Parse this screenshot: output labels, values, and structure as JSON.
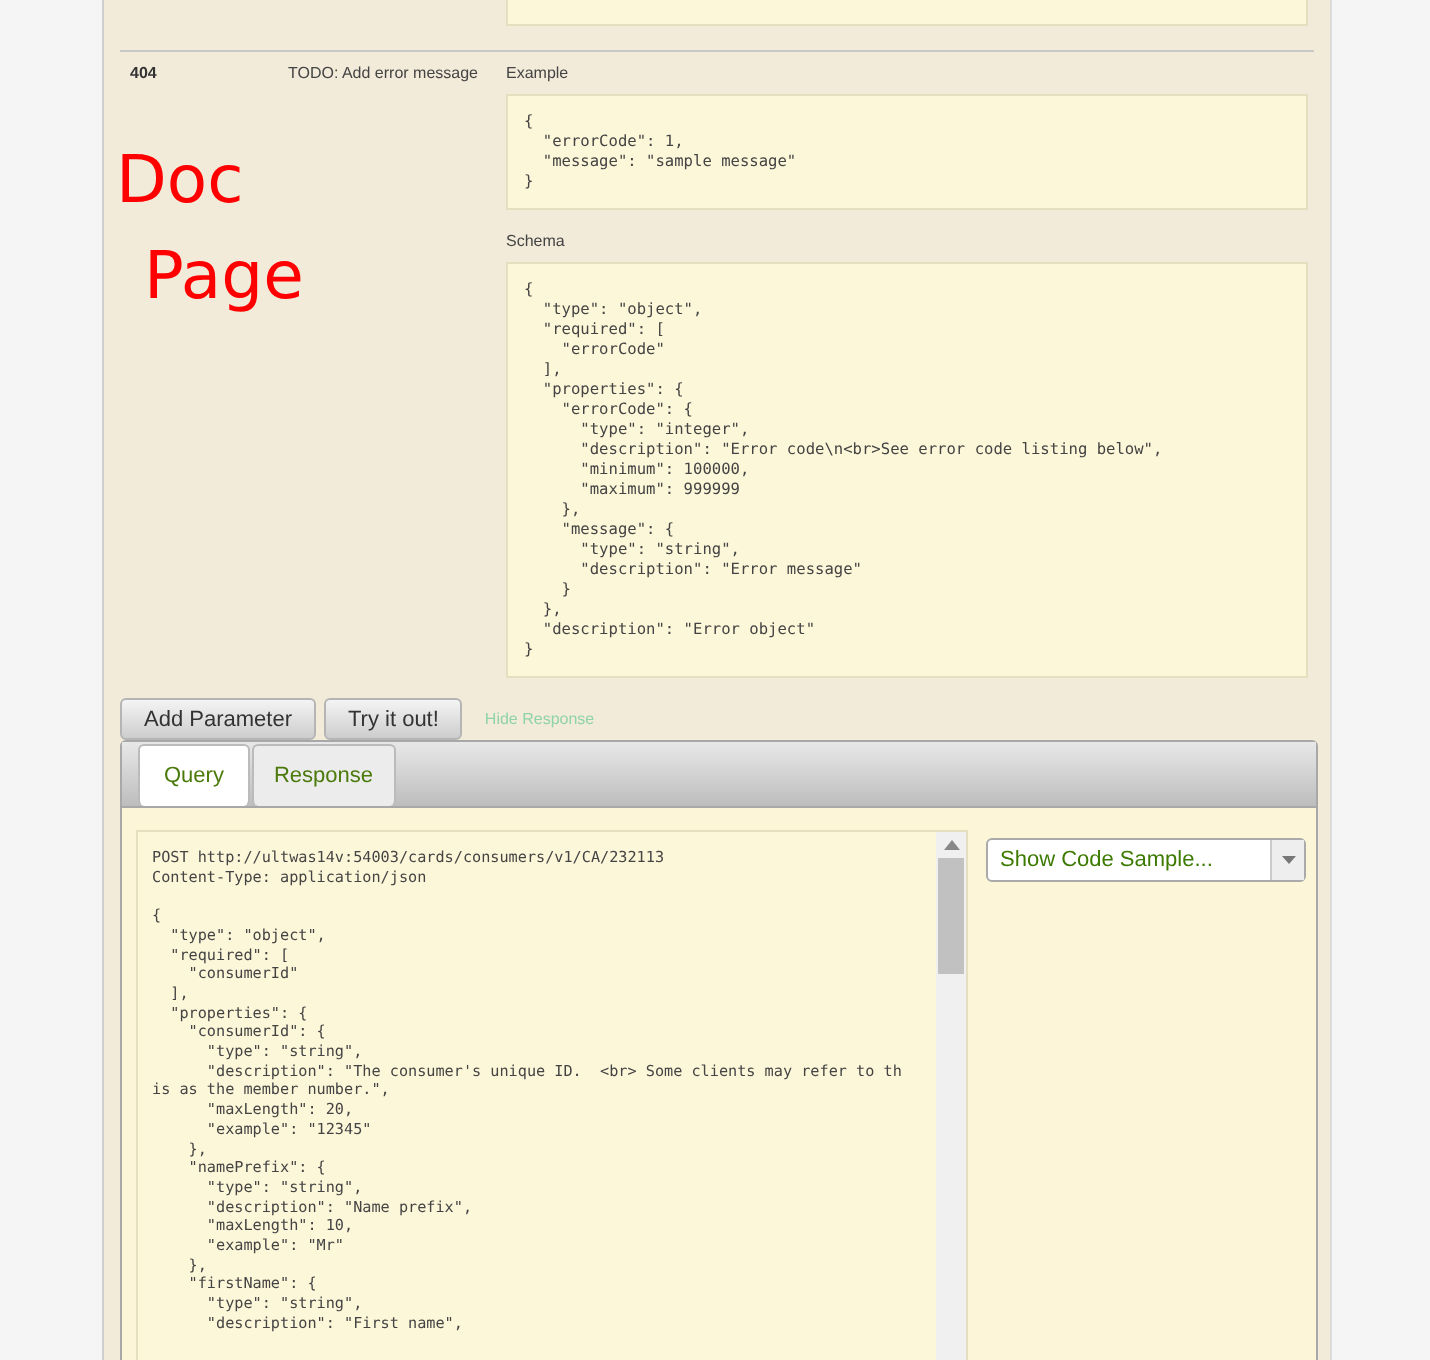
{
  "annotation": {
    "lines": [
      "Doc",
      "Page"
    ]
  },
  "responses": [
    {
      "code": "404",
      "message": "TODO: Add error message",
      "example_label": "Example",
      "example": [
        "{",
        "  \"errorCode\": 1,",
        "  \"message\": \"sample message\"",
        "}"
      ],
      "schema_label": "Schema",
      "schema": [
        "{",
        "  \"type\": \"object\",",
        "  \"required\": [",
        "    \"errorCode\"",
        "  ],",
        "  \"properties\": {",
        "    \"errorCode\": {",
        "      \"type\": \"integer\",",
        "      \"description\": \"Error code\\n<br>See error code listing below\",",
        "      \"minimum\": 100000,",
        "      \"maximum\": 999999",
        "    },",
        "    \"message\": {",
        "      \"type\": \"string\",",
        "      \"description\": \"Error message\"",
        "    }",
        "  },",
        "  \"description\": \"Error object\"",
        "}"
      ]
    }
  ],
  "buttons": [
    {
      "label": "Add Parameter"
    },
    {
      "label": "Try it out!"
    }
  ],
  "hide_response_link": "Hide Response",
  "tabs": [
    {
      "label": "Query",
      "selected": true
    },
    {
      "label": "Response",
      "selected": false
    }
  ],
  "query_header": [
    "POST http://ultwas14v:54003/cards/consumers/v1/CA/232113",
    "Content-Type: application/json"
  ],
  "query": [
    "{",
    "  \"type\": \"object\",",
    "  \"required\": [",
    "    \"consumerId\"",
    "  ],",
    "  \"properties\": {",
    "    \"consumerId\": {",
    "      \"type\": \"string\",",
    "      \"description\": \"The consumer's unique ID.  <br> Some clients may refer to th",
    "is as the member number.\",",
    "      \"maxLength\": 20,",
    "      \"example\": \"12345\"",
    "    },",
    "    \"namePrefix\": {",
    "      \"type\": \"string\",",
    "      \"description\": \"Name prefix\",",
    "      \"maxLength\": 10,",
    "      \"example\": \"Mr\"",
    "    },",
    "    \"firstName\": {",
    "      \"type\": \"string\",",
    "      \"description\": \"First name\","
  ],
  "code_sample_select": {
    "value": "Show Code Sample..."
  }
}
